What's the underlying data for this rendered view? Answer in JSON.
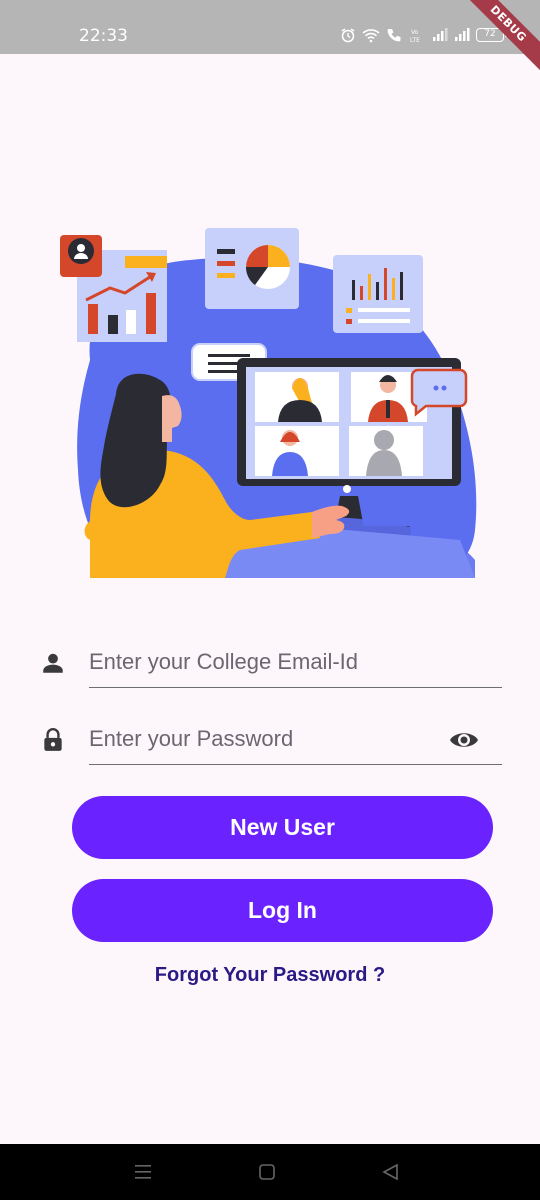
{
  "status_bar": {
    "time": "22:33",
    "battery": "72",
    "icons": [
      "alarm-icon",
      "wifi-icon",
      "call-icon",
      "volte-icon",
      "signal-icon",
      "signal-icon",
      "battery-icon"
    ]
  },
  "debug_banner": "DEBUG",
  "illustration": {
    "icon": "video-conference-illustration",
    "colors": {
      "blob": "#5b6ef0",
      "shirt": "#fbb11e",
      "monitor": "#2b2b33",
      "card": "#c7d0fb",
      "accent": "#d4472a"
    }
  },
  "form": {
    "email_placeholder": "Enter your College Email-Id",
    "password_placeholder": "Enter your Password",
    "email_icon": "person-icon",
    "password_icon": "lock-icon",
    "visibility_icon": "eye-icon"
  },
  "buttons": {
    "new_user": "New User",
    "login": "Log In",
    "forgot": "Forgot Your Password ?"
  },
  "colors": {
    "primary": "#6a22ff",
    "link": "#2a1a86",
    "background": "#fdf7fb"
  },
  "nav_bar": {
    "icons": [
      "menu-icon",
      "home-icon",
      "back-icon"
    ]
  }
}
